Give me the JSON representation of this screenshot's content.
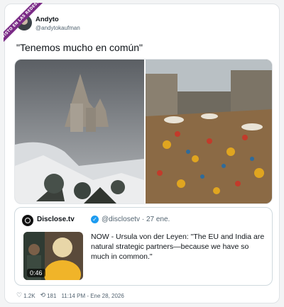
{
  "watermark": "VISTO EN LAS REDES.COM",
  "tweet": {
    "author_name": "Andyto",
    "author_handle": "@andytokaufman",
    "text": "\"Tenemos mucho en común\""
  },
  "quote": {
    "source_name": "Disclose.tv",
    "source_handle": "@disclosetv · 27 ene.",
    "text": "NOW - Ursula von der Leyen: \"The EU and India are natural strategic partners—because we have so much in common.\"",
    "video_duration": "0:46"
  },
  "footer": {
    "likes": "1.2K",
    "retweets": "181",
    "timestamp": "11:14 PM - Ene 28, 2026"
  },
  "colors": {
    "verified": "#1d9bf0",
    "secondary_text": "#536471",
    "ribbon": "#7a2a86"
  }
}
